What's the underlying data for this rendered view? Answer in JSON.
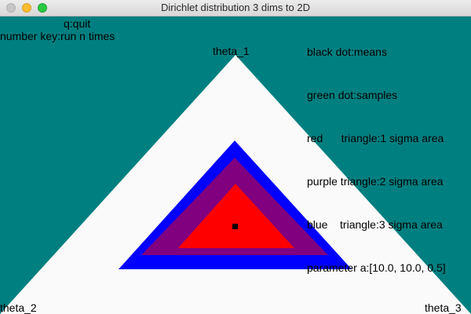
{
  "window": {
    "title": "Dirichlet distribution 3 dims to 2D"
  },
  "help": {
    "quit": "q:quit",
    "run": "number key:run n times"
  },
  "legend": {
    "items": [
      "black dot:means",
      "green dot:samples",
      "red      triangle:1 sigma area",
      "purple triangle:2 sigma area",
      "blue    triangle:3 sigma area",
      "parameter a:[10.0, 10.0, 0.5]"
    ]
  },
  "vertices": {
    "top": "theta_1",
    "bottom_left": "theta_2",
    "bottom_right": "theta_3"
  },
  "colors": {
    "background": "#007f80",
    "simplex": "#fafafa",
    "sigma1": "#ff0000",
    "sigma2": "#800080",
    "sigma3": "#0000ff",
    "mean": "#000000"
  }
}
